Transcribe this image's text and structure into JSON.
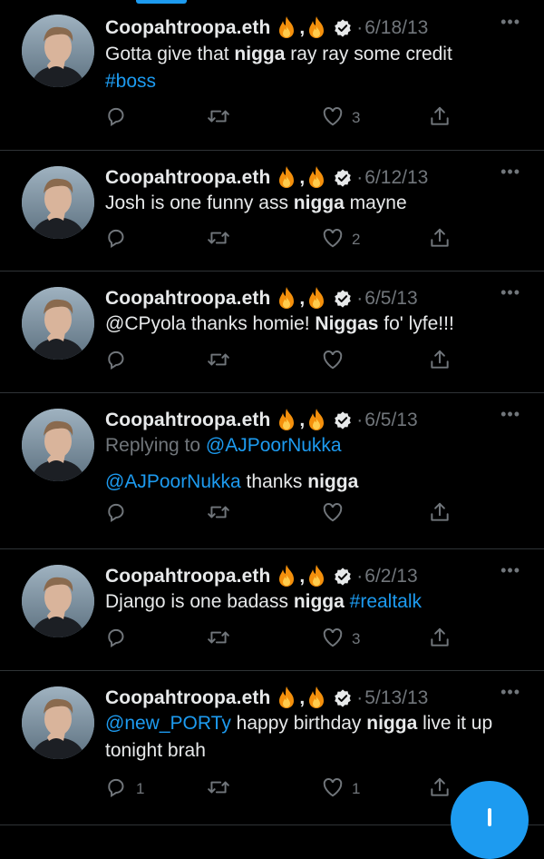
{
  "author": {
    "name": "Coopahtroopa.eth",
    "comma": ",",
    "emoji_icon": "fire-icon",
    "verified_icon": "verified-badge-icon"
  },
  "accent": "#1d9bf0",
  "tweets": [
    {
      "date": "6/18/13",
      "segments": [
        [
          {
            "t": "Gotta give that ",
            "s": "n"
          },
          {
            "t": "nigga",
            "s": "b"
          },
          {
            "t": " ray ray some credit",
            "s": "n"
          }
        ],
        [
          {
            "t": "#boss",
            "s": "l"
          }
        ]
      ],
      "replies": "",
      "likes": "3"
    },
    {
      "date": "6/12/13",
      "segments": [
        [
          {
            "t": "Josh is one funny ass ",
            "s": "n"
          },
          {
            "t": "nigga",
            "s": "b"
          },
          {
            "t": " mayne",
            "s": "n"
          }
        ]
      ],
      "replies": "",
      "likes": "2"
    },
    {
      "date": "6/5/13",
      "segments": [
        [
          {
            "t": "@CPyola thanks homie! ",
            "s": "n"
          },
          {
            "t": "Niggas",
            "s": "b"
          },
          {
            "t": " fo' lyfe!!!",
            "s": "n"
          }
        ]
      ],
      "replies": "",
      "likes": ""
    },
    {
      "date": "6/5/13",
      "replying_to": {
        "label": "Replying to ",
        "handle": "@AJPoorNukka"
      },
      "segments": [
        [
          {
            "t": "@AJPoorNukka",
            "s": "l"
          },
          {
            "t": " thanks ",
            "s": "n"
          },
          {
            "t": "nigga",
            "s": "b"
          }
        ]
      ],
      "replies": "",
      "likes": ""
    },
    {
      "date": "6/2/13",
      "segments": [
        [
          {
            "t": "Django is one badass ",
            "s": "n"
          },
          {
            "t": "nigga",
            "s": "b"
          },
          {
            "t": " ",
            "s": "n"
          },
          {
            "t": "#realtalk",
            "s": "l"
          }
        ]
      ],
      "replies": "",
      "likes": "3"
    },
    {
      "date": "5/13/13",
      "segments": [
        [
          {
            "t": "@new_PORTy",
            "s": "l"
          },
          {
            "t": " happy birthday ",
            "s": "n"
          },
          {
            "t": "nigga",
            "s": "b"
          },
          {
            "t": " live it up",
            "s": "n"
          }
        ],
        [
          {
            "t": "tonight brah",
            "s": "n"
          }
        ]
      ],
      "replies": "1",
      "likes": "1"
    }
  ],
  "icons": {
    "reply": "reply-icon",
    "retweet": "retweet-icon",
    "like": "heart-icon",
    "share": "share-icon",
    "more": "more-icon"
  },
  "fab_icon": "compose-plus-icon"
}
